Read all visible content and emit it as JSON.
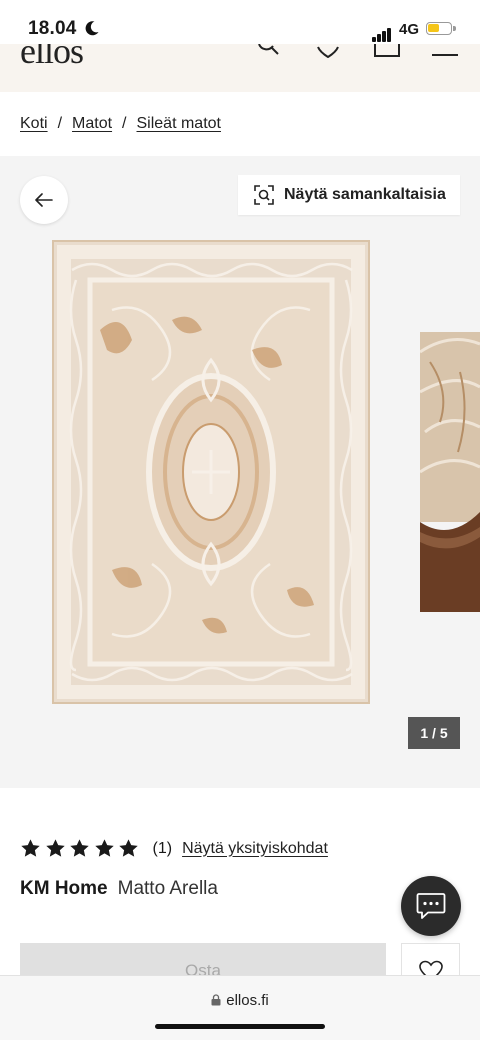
{
  "status_bar": {
    "time": "18.04",
    "network": "4G",
    "battery_level": 0.45,
    "battery_color": "#f5c518"
  },
  "header": {
    "logo": "ellos",
    "icons": [
      "search-icon",
      "heart-icon",
      "bag-icon",
      "menu-icon"
    ]
  },
  "breadcrumb": {
    "items": [
      "Koti",
      "Matot",
      "Sileät matot"
    ],
    "separator": "/"
  },
  "gallery": {
    "similar_label": "Näytä samankaltaisia",
    "counter": {
      "current": "1",
      "separator": "/",
      "total": "5"
    }
  },
  "product": {
    "rating_stars": 5,
    "review_count": "(1)",
    "details_link": "Näytä yksityiskohdat",
    "brand": "KM Home",
    "name": "Matto Arella",
    "buy_label": "Osta"
  },
  "browser": {
    "url": "ellos.fi"
  },
  "colors": {
    "rug_base": "#e7d5c2",
    "rug_accent": "#c99c6e",
    "header_bg": "#f8f4ef",
    "gallery_bg": "#f4f4f4"
  }
}
